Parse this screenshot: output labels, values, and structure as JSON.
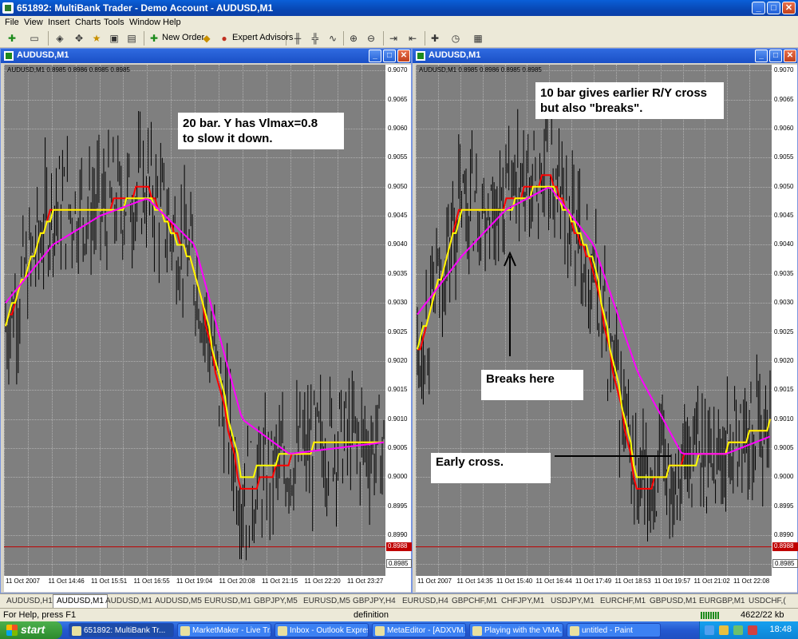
{
  "window": {
    "title": "651892: MultiBank Trader - Demo Account - AUDUSD,M1",
    "controls": [
      "_",
      "□",
      "✕"
    ]
  },
  "menu": [
    "File",
    "View",
    "Insert",
    "Charts",
    "Tools",
    "Window",
    "Help"
  ],
  "toolbar": {
    "new_order_label": "New Order",
    "expert_advisors_label": "Expert Advisors"
  },
  "charts": [
    {
      "window_title": "AUDUSD,M1",
      "info_line": "AUDUSD,M1  0.8985 0.8986 0.8985 0.8985",
      "price_labels": [
        "0.9070",
        "0.9065",
        "0.9060",
        "0.9055",
        "0.9050",
        "0.9045",
        "0.9040",
        "0.9035",
        "0.9030",
        "0.9025",
        "0.9020",
        "0.9015",
        "0.9010",
        "0.9005",
        "0.9000",
        "0.8995",
        "0.8990",
        "0.8985"
      ],
      "bid_badge": "0.8988",
      "current_badge": "0.8985",
      "time_labels": [
        "11 Oct 2007",
        "11 Oct 14:46",
        "11 Oct 15:51",
        "11 Oct 16:55",
        "11 Oct 19:04",
        "11 Oct 20:08",
        "11 Oct 21:15",
        "11 Oct 22:20",
        "11 Oct 23:27"
      ],
      "annotation": [
        "20 bar. Y has Vlmax=0.8",
        "to slow it down."
      ]
    },
    {
      "window_title": "AUDUSD,M1",
      "info_line": "AUDUSD,M1  0.8985 0.8986 0.8985 0.8985",
      "price_labels": [
        "0.9070",
        "0.9065",
        "0.9060",
        "0.9055",
        "0.9050",
        "0.9045",
        "0.9040",
        "0.9035",
        "0.9030",
        "0.9025",
        "0.9020",
        "0.9015",
        "0.9010",
        "0.9005",
        "0.9000",
        "0.8995",
        "0.8990",
        "0.8985"
      ],
      "bid_badge": "0.8988",
      "current_badge": "0.8985",
      "time_labels": [
        "11 Oct 2007",
        "11 Oct 14:35",
        "11 Oct 15:40",
        "11 Oct 16:44",
        "11 Oct 17:49",
        "11 Oct 18:53",
        "11 Oct 19:57",
        "11 Oct 21:02",
        "11 Oct 22:08"
      ],
      "annotation": [
        "10 bar gives earlier R/Y cross",
        "but also \"breaks\"."
      ],
      "breaks_label": "Breaks here",
      "cross_label": "Early cross."
    }
  ],
  "tabs": [
    "AUDUSD,H1",
    "AUDUSD,M1",
    "AUDUSD,M1",
    "AUDUSD,M5",
    "EURUSD,M1",
    "GBPJPY,M5",
    "EURUSD,M5",
    "GBPJPY,H4",
    "EURUSD,H4",
    "GBPCHF,M1",
    "CHFJPY,M1",
    "USDJPY,M1",
    "EURCHF,M1",
    "GBPUSD,M1",
    "EURGBP,M1",
    "USDCHF,("
  ],
  "active_tab_index": 1,
  "status": {
    "help": "For Help, press F1",
    "profile": "definition",
    "traffic": "4622/22 kb"
  },
  "taskbar": {
    "start_label": "start",
    "tasks": [
      "651892: MultiBank Tr...",
      "MarketMaker - Live Tr...",
      "Inbox - Outlook Express",
      "MetaEditor - [ADXVM...",
      "Playing with the VMA...",
      "untitled - Paint"
    ],
    "clock": "18:48"
  },
  "colors": {
    "red_line": "#ff0000",
    "yellow_line": "#ffff00",
    "magenta_line": "#ff00ff",
    "price_bars": "#000000",
    "chart_background": "#7f7f7f"
  },
  "chart_data": [
    {
      "type": "line",
      "title": "AUDUSD,M1",
      "x": [
        "11 Oct 2007",
        "11 Oct 14:46",
        "11 Oct 15:51",
        "11 Oct 16:55",
        "11 Oct 19:04",
        "11 Oct 20:08",
        "11 Oct 21:15",
        "11 Oct 22:20",
        "11 Oct 23:27"
      ],
      "series": [
        {
          "values": [
            0.9026,
            0.9047,
            0.9046,
            0.905,
            0.9036,
            0.8997,
            0.9003,
            0.9007,
            0.9005
          ]
        },
        {
          "values": [
            0.9027,
            0.9046,
            0.9045,
            0.9049,
            0.9036,
            0.9,
            0.9004,
            0.9006,
            0.9005
          ]
        },
        {
          "values": [
            0.903,
            0.904,
            0.9045,
            0.9048,
            0.904,
            0.901,
            0.9004,
            0.9005,
            0.9006
          ]
        }
      ],
      "ylim": [
        0.8983,
        0.9071
      ]
    },
    {
      "type": "line",
      "title": "AUDUSD,M1",
      "x": [
        "11 Oct 2007",
        "11 Oct 14:35",
        "11 Oct 15:40",
        "11 Oct 16:44",
        "11 Oct 17:49",
        "11 Oct 18:53",
        "11 Oct 19:57",
        "11 Oct 21:02",
        "11 Oct 22:08"
      ],
      "series": [
        {
          "values": [
            0.9021,
            0.9047,
            0.9047,
            0.9052,
            0.9036,
            0.8997,
            0.9003,
            0.9005,
            0.9009
          ]
        },
        {
          "values": [
            0.9022,
            0.9046,
            0.9046,
            0.9051,
            0.9037,
            0.8999,
            0.9002,
            0.9005,
            0.9009
          ]
        },
        {
          "values": [
            0.9028,
            0.9038,
            0.9046,
            0.905,
            0.904,
            0.9018,
            0.9004,
            0.9004,
            0.9007
          ]
        }
      ],
      "ylim": [
        0.8983,
        0.9071
      ]
    }
  ]
}
